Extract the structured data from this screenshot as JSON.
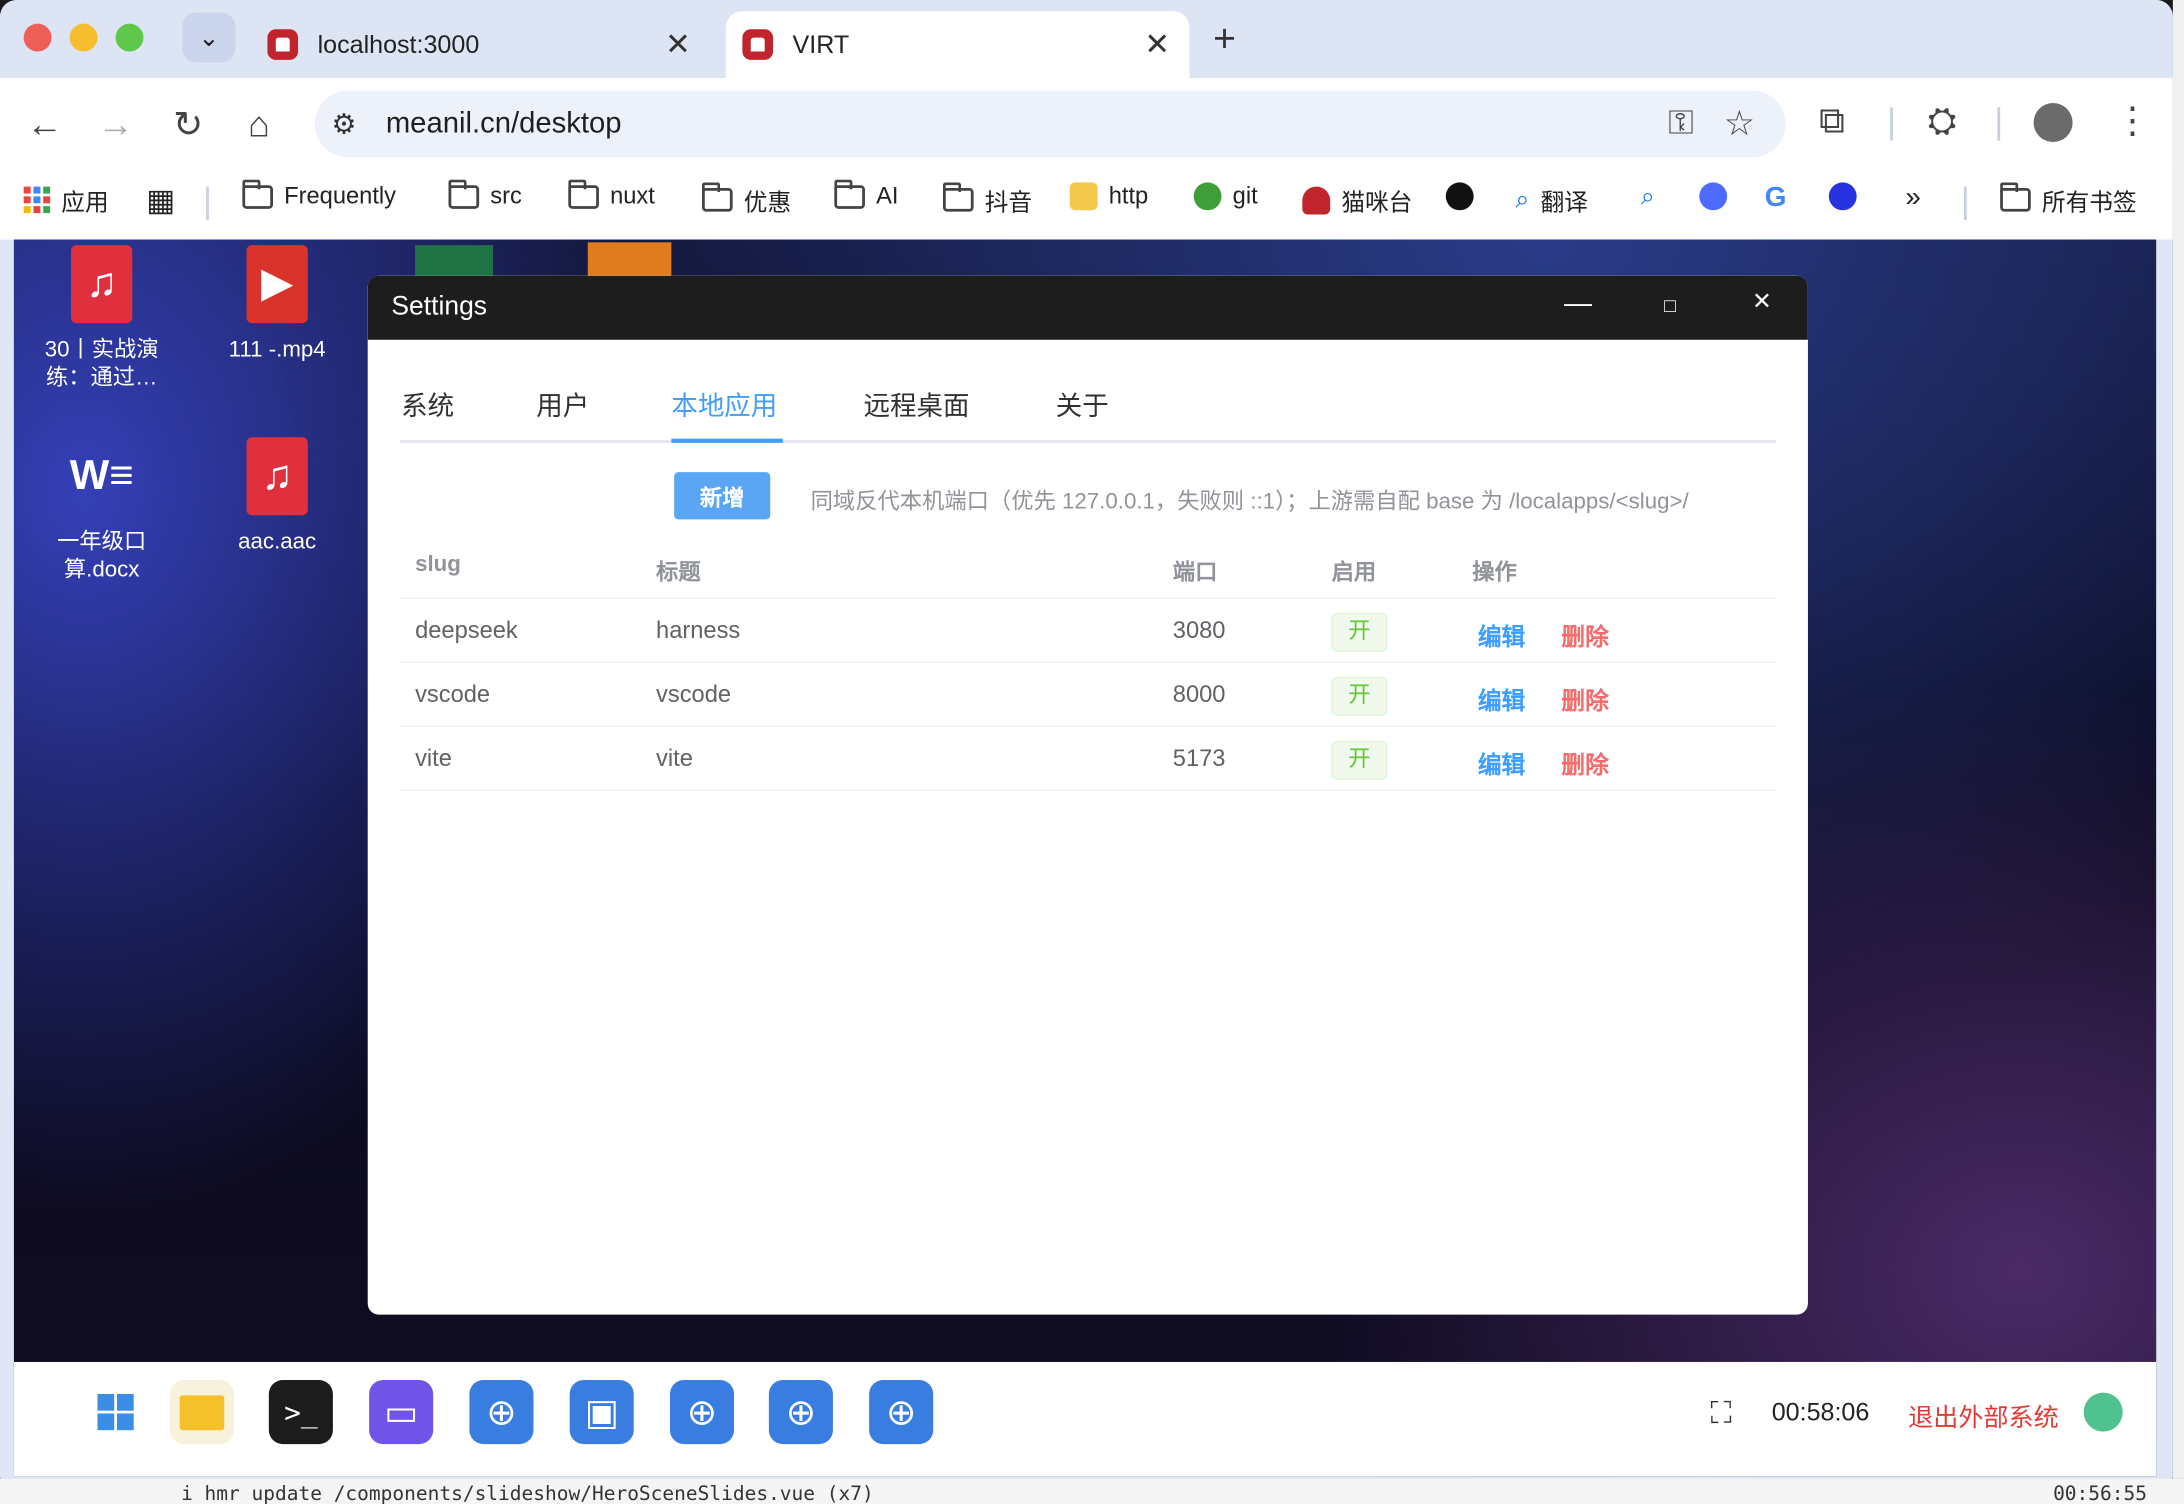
{
  "browser": {
    "tabs": [
      {
        "title": "localhost:3000"
      },
      {
        "title": "VIRT"
      }
    ],
    "url": "meanil.cn/desktop",
    "bookmarks": [
      "应用",
      "Frequently",
      "src",
      "nuxt",
      "优惠",
      "AI",
      "抖音",
      "http",
      "git",
      "猫咪台",
      "翻译",
      "所有书签"
    ]
  },
  "desktop": {
    "icons": [
      {
        "label": "30丨实战演练：通过…",
        "type": "music"
      },
      {
        "label": "111 -.mp4",
        "type": "video"
      },
      {
        "label": "一年级口算.docx",
        "type": "word"
      },
      {
        "label": "aac.aac",
        "type": "music"
      }
    ]
  },
  "settings": {
    "title": "Settings",
    "tabs": [
      "系统",
      "用户",
      "本地应用",
      "远程桌面",
      "关于"
    ],
    "active_tab": "本地应用",
    "add_button": "新增",
    "hint": "同域反代本机端口（优先 127.0.0.1，失败则 ::1）；上游需自配 base 为 /localapps/<slug>/",
    "columns": [
      "slug",
      "标题",
      "端口",
      "启用",
      "操作"
    ],
    "rows": [
      {
        "slug": "deepseek",
        "title": "harness",
        "port": "3080",
        "enabled": "开",
        "edit": "编辑",
        "delete": "删除"
      },
      {
        "slug": "vscode",
        "title": "vscode",
        "port": "8000",
        "enabled": "开",
        "edit": "编辑",
        "delete": "删除"
      },
      {
        "slug": "vite",
        "title": "vite",
        "port": "5173",
        "enabled": "开",
        "edit": "编辑",
        "delete": "删除"
      }
    ]
  },
  "taskbar": {
    "clock": "00:58:06",
    "exit_label": "退出外部系统"
  },
  "terminal": {
    "line": "i hmr update /components/slideshow/HeroSceneSlides.vue (x7)",
    "time": "00:56:55"
  },
  "colors": {
    "accent": "#409eff",
    "danger": "#f56c6c",
    "success": "#67c23a",
    "exit": "#e53935"
  }
}
